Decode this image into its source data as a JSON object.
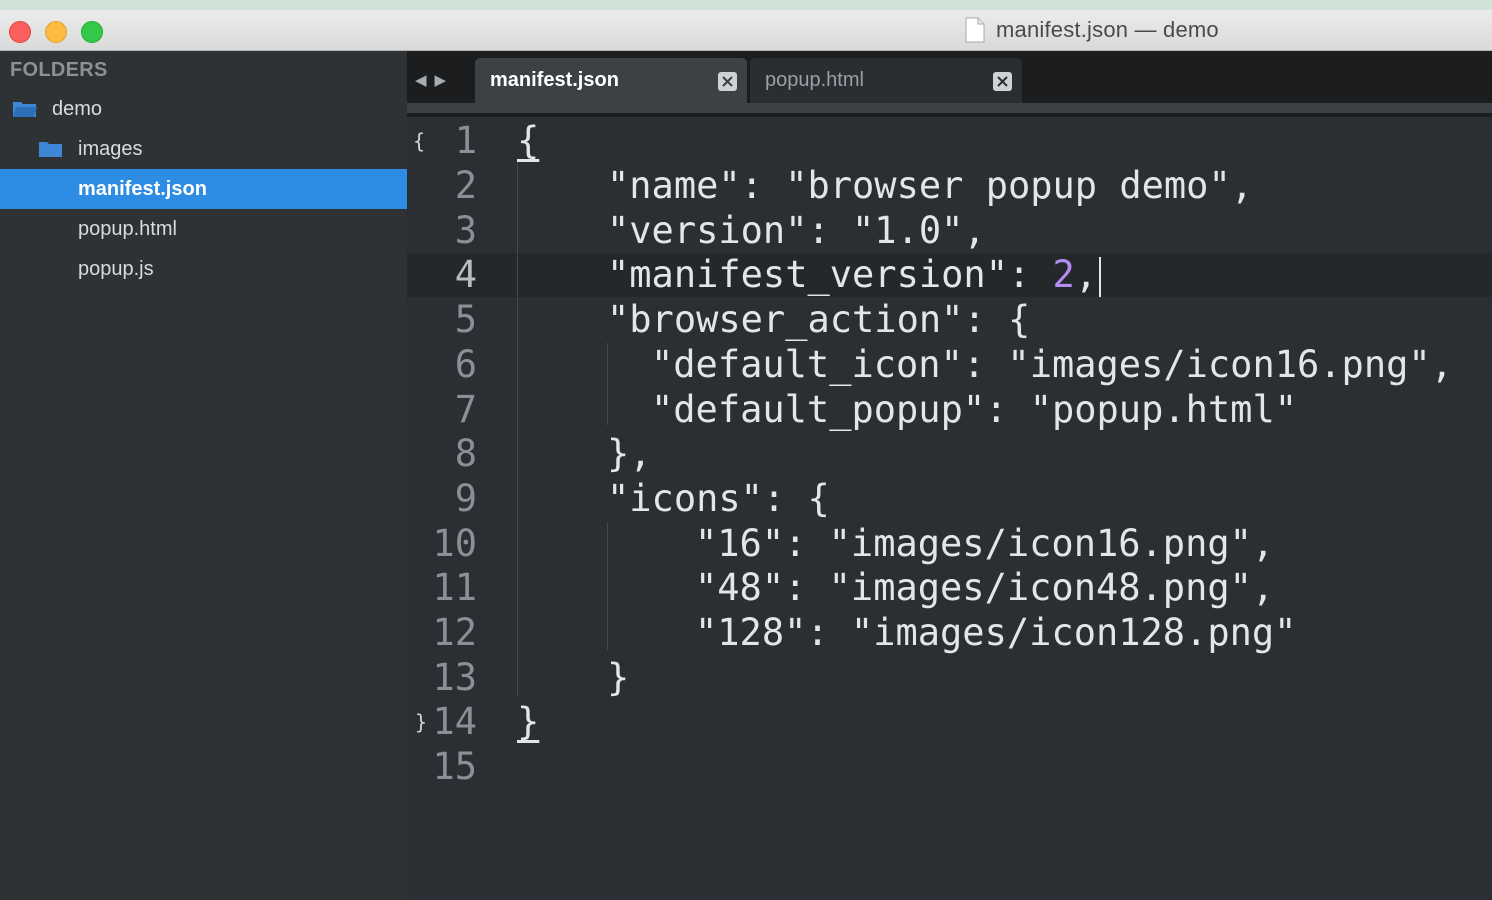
{
  "window": {
    "title": "manifest.json — demo"
  },
  "sidebar": {
    "header": "FOLDERS",
    "items": [
      {
        "label": "demo",
        "type": "folder-open"
      },
      {
        "label": "images",
        "type": "folder"
      },
      {
        "label": "manifest.json",
        "type": "file",
        "selected": true
      },
      {
        "label": "popup.html",
        "type": "file"
      },
      {
        "label": "popup.js",
        "type": "file"
      }
    ]
  },
  "tabs": [
    {
      "label": "manifest.json",
      "active": true
    },
    {
      "label": "popup.html",
      "active": false
    }
  ],
  "tab_nav": {
    "prev": "◀",
    "next": "▶"
  },
  "editor": {
    "fold_open": "{",
    "fold_close": "}",
    "line_numbers": [
      "1",
      "2",
      "3",
      "4",
      "5",
      "6",
      "7",
      "8",
      "9",
      "10",
      "11",
      "12",
      "13",
      "14",
      "15"
    ],
    "lines": [
      "{",
      "\"name\": \"browser popup demo\",",
      "\"version\": \"1.0\",",
      "\"manifest_version\": ",
      "\"browser_action\": {",
      "\"default_icon\": \"images/icon16.png\",",
      "\"default_popup\": \"popup.html\"",
      "},",
      "\"icons\": {",
      "\"16\": \"images/icon16.png\",",
      "\"48\": \"images/icon48.png\",",
      "\"128\": \"images/icon128.png\"",
      "}",
      "}",
      ""
    ],
    "line4_number": "2",
    "line4_tail": ",",
    "current_line": 4
  },
  "colors": {
    "sidebar_bg": "#2e3235",
    "selection": "#2d8ce3",
    "editor_bg": "#2b2f33",
    "number_literal": "#b38ef0",
    "text": "#e3e6e8"
  }
}
